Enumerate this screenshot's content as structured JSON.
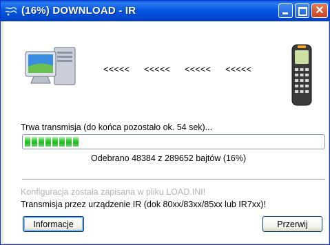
{
  "window": {
    "title": "(16%) DOWNLOAD - IR"
  },
  "transfer": {
    "arrows": [
      "<<<<<",
      "<<<<<",
      "<<<<<",
      "<<<<<"
    ],
    "status_label": "Trwa transmisja (do końca pozostało ok. 54 sek)...",
    "progress_fraction": 0.16,
    "received_text": "Odebrano 48384 z 289652 bajtów (16%)"
  },
  "messages": {
    "config_saved": "Konfiguracja została zapisana w pliku LOAD.INI!",
    "ir_transfer": "Transmisja przez urządzenie IR (dok 80xx/83xx/85xx lub IR7xx)!"
  },
  "buttons": {
    "info": "Informacje",
    "stop": "Przerwij"
  },
  "colors": {
    "titlebar": "#0758e0",
    "progress_fill": "#23b823",
    "disabled_text": "#b5b5b5"
  },
  "icons": [
    "app-icon",
    "computer-icon",
    "scanner-device-icon"
  ]
}
